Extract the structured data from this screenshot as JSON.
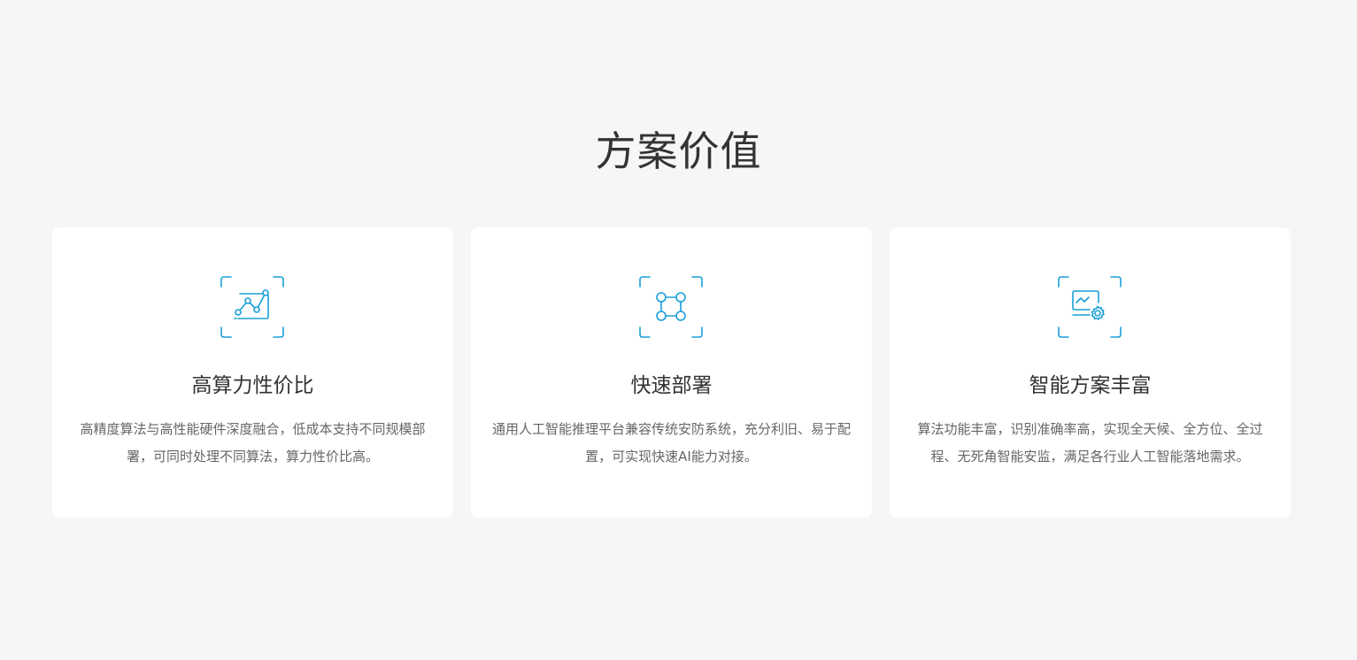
{
  "section": {
    "title": "方案价值"
  },
  "colors": {
    "background": "#f5f6f8",
    "card": "#ffffff",
    "icon_accent": "#1a9fd8",
    "title_text": "#333333",
    "desc_text": "#666666"
  },
  "cards": [
    {
      "icon": "line-chart-icon",
      "title": "高算力性价比",
      "desc": "高精度算法与高性能硬件深度融合，低成本支持不同规模部署，可同时处理不同算法，算力性价比高。"
    },
    {
      "icon": "node-network-icon",
      "title": "快速部署",
      "desc": "通用人工智能推理平台兼容传统安防系统，充分利旧、易于配置，可实现快速AI能力对接。"
    },
    {
      "icon": "monitor-settings-icon",
      "title": "智能方案丰富",
      "desc": "算法功能丰富，识别准确率高，实现全天候、全方位、全过程、无死角智能安监，满足各行业人工智能落地需求。"
    }
  ]
}
